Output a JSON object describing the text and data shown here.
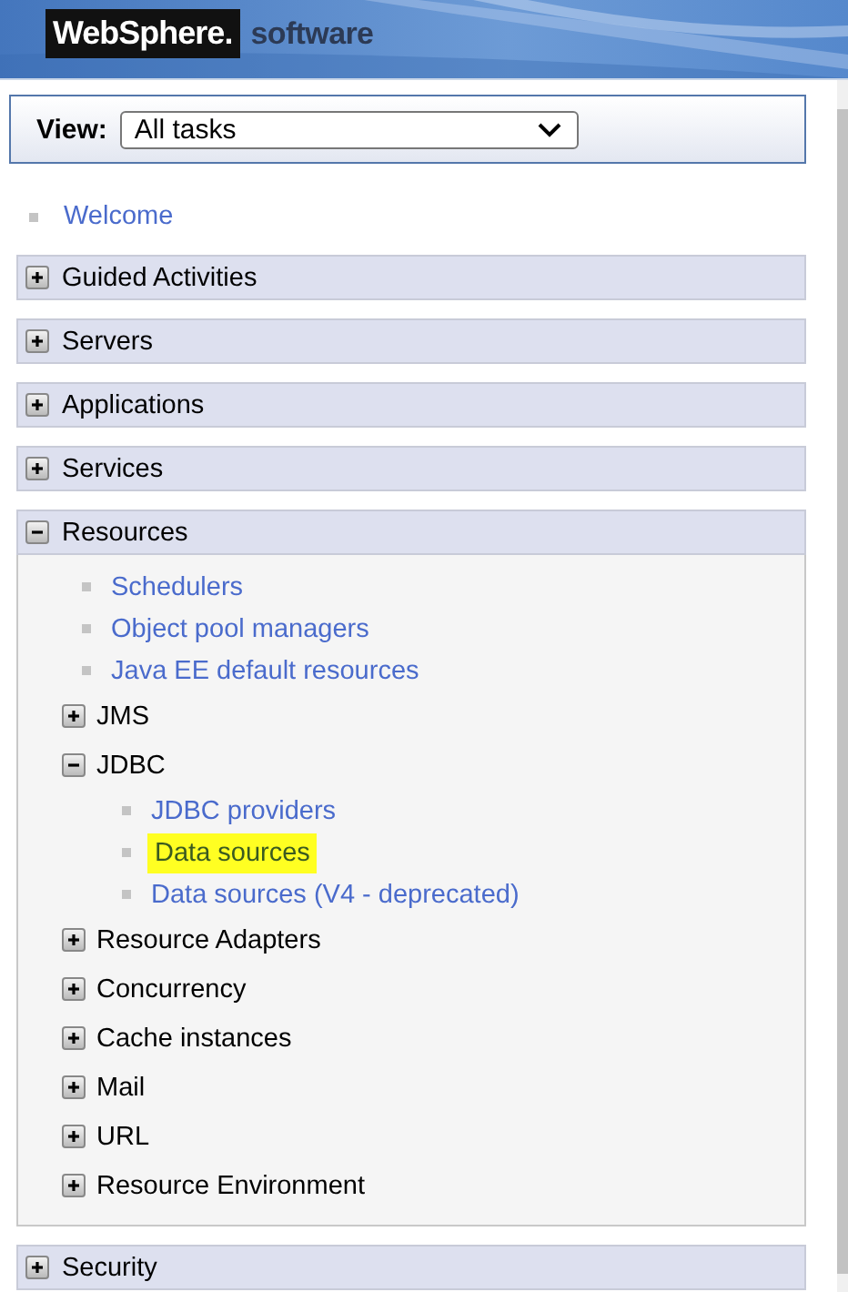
{
  "header": {
    "logo": "WebSphere.",
    "product": "software"
  },
  "view": {
    "label": "View:",
    "value": "All tasks"
  },
  "welcome": {
    "label": "Welcome"
  },
  "sections": [
    {
      "label": "Guided Activities",
      "expanded": false
    },
    {
      "label": "Servers",
      "expanded": false
    },
    {
      "label": "Applications",
      "expanded": false
    },
    {
      "label": "Services",
      "expanded": false
    },
    {
      "label": "Resources",
      "expanded": true,
      "children": [
        {
          "kind": "link",
          "label": "Schedulers",
          "selected": false
        },
        {
          "kind": "link",
          "label": "Object pool managers",
          "selected": false
        },
        {
          "kind": "link",
          "label": "Java EE default resources",
          "selected": false
        },
        {
          "kind": "group",
          "label": "JMS",
          "expanded": false
        },
        {
          "kind": "group",
          "label": "JDBC",
          "expanded": true,
          "children": [
            {
              "kind": "link",
              "label": "JDBC providers",
              "selected": false
            },
            {
              "kind": "link",
              "label": "Data sources",
              "selected": true
            },
            {
              "kind": "link",
              "label": "Data sources (V4 - deprecated)",
              "selected": false
            }
          ]
        },
        {
          "kind": "group",
          "label": "Resource Adapters",
          "expanded": false
        },
        {
          "kind": "group",
          "label": "Concurrency",
          "expanded": false
        },
        {
          "kind": "group",
          "label": "Cache instances",
          "expanded": false
        },
        {
          "kind": "group",
          "label": "Mail",
          "expanded": false
        },
        {
          "kind": "group",
          "label": "URL",
          "expanded": false
        },
        {
          "kind": "group",
          "label": "Resource Environment",
          "expanded": false
        }
      ]
    },
    {
      "label": "Security",
      "expanded": false
    }
  ]
}
